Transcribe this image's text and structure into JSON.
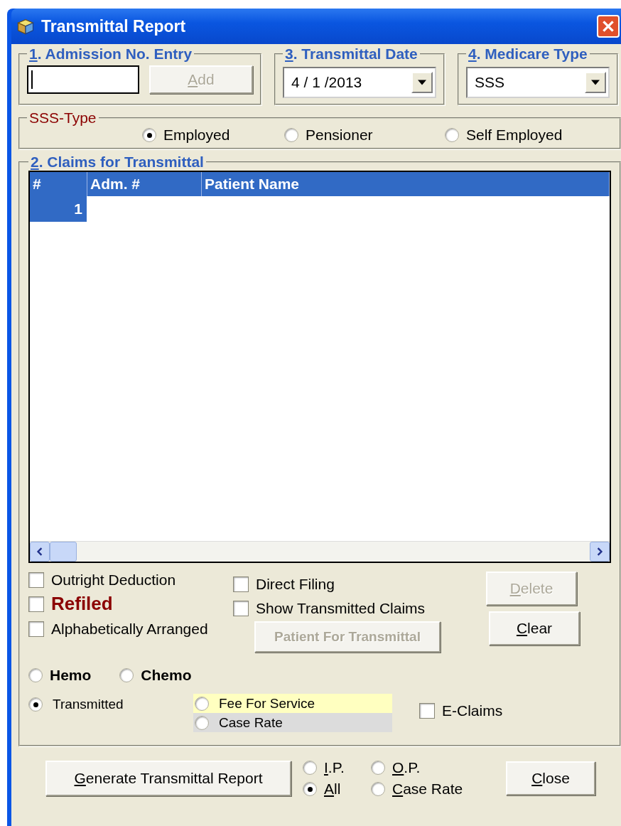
{
  "window": {
    "title": "Transmittal Report"
  },
  "admission": {
    "legend": "1. Admission No. Entry",
    "hotkey": true,
    "add_button": {
      "label": "Add",
      "hotkey": true,
      "disabled": true
    }
  },
  "transmittal_date": {
    "legend": "3. Transmittal Date",
    "hotkey": true,
    "value": "4 / 1 /2013"
  },
  "medicare_type": {
    "legend": "4. Medicare Type",
    "hotkey": true,
    "value": "SSS"
  },
  "sss_type": {
    "legend": "SSS-Type",
    "options": [
      {
        "label": "Employed",
        "selected": true
      },
      {
        "label": "Pensioner",
        "selected": false
      },
      {
        "label": "Self Employed",
        "selected": false
      }
    ]
  },
  "claims": {
    "legend": "2. Claims for Transmittal",
    "hotkey": true,
    "columns": [
      "#",
      "Adm. #",
      "Patient Name"
    ],
    "rows": [
      {
        "number": "1",
        "selected": true
      }
    ]
  },
  "left_checks": [
    {
      "label": "Outright Deduction",
      "kind": "plain",
      "checked": false
    },
    {
      "label": "Refiled",
      "kind": "emphasis",
      "checked": false
    },
    {
      "label": "Alphabetically Arranged",
      "kind": "plain",
      "checked": false
    }
  ],
  "mid_checks": [
    {
      "label": "Direct Filing",
      "checked": false
    },
    {
      "label": "Show Transmitted Claims",
      "checked": false
    }
  ],
  "patient_button": {
    "label": "Patient For Transmittal",
    "disabled": true
  },
  "delete_button": {
    "label": "Delete",
    "hotkey": true,
    "disabled": true
  },
  "clear_button": {
    "label": "Clear",
    "hotkey": true,
    "disabled": false
  },
  "therapy": [
    {
      "label": "Hemo",
      "selected": false
    },
    {
      "label": "Chemo",
      "selected": false
    }
  ],
  "transmitted": {
    "label": "Transmitted",
    "selected": true
  },
  "payment": [
    {
      "label": "Fee For Service",
      "selected": false,
      "color": "#ffffc0"
    },
    {
      "label": "Case Rate",
      "selected": false,
      "color": "#dcdcdc"
    }
  ],
  "e_claims": {
    "label": "E-Claims",
    "checked": false
  },
  "generate_button": {
    "label": "Generate Transmittal Report",
    "hotkey": true
  },
  "patient_type": [
    {
      "label": "I.P.",
      "hotkey": true,
      "selected": false
    },
    {
      "label": "O.P.",
      "hotkey": true,
      "selected": false
    },
    {
      "label": "All",
      "hotkey": true,
      "selected": true
    },
    {
      "label": "Case Rate",
      "hotkey": true,
      "selected": false
    }
  ],
  "close_button": {
    "label": "Close",
    "hotkey": true
  }
}
